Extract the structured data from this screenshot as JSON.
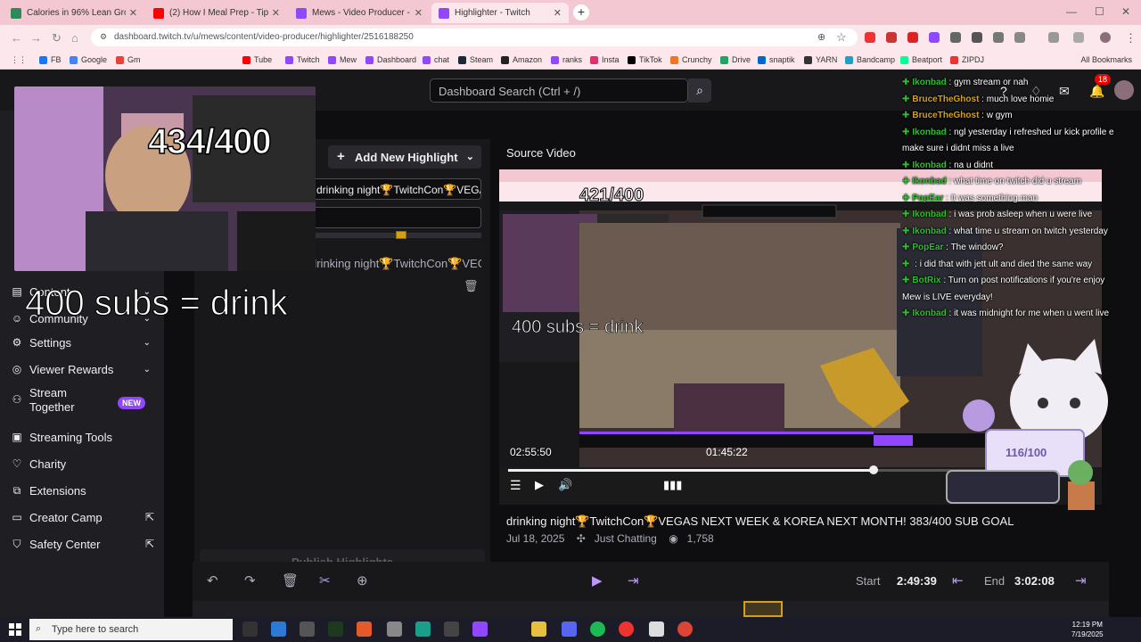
{
  "browser": {
    "tabs": [
      {
        "label": "Calories in 96% Lean Ground B",
        "color": "#2e8b57"
      },
      {
        "label": "(2) How I Meal Prep - Tips & Tr",
        "color": "#ff0000"
      },
      {
        "label": "Mews - Video Producer - Twitc",
        "color": "#9147ff"
      },
      {
        "label": "Highlighter - Twitch",
        "color": "#9147ff"
      }
    ],
    "url": "dashboard.twitch.tv/u/mews/content/video-producer/highlighter/2516188250",
    "bookmarks": [
      "FB",
      "Google",
      "Gm",
      "Tube",
      "Twitch",
      "Mew",
      "Dashboard",
      "chat",
      "Steam",
      "Amazon",
      "ranks",
      "Insta",
      "TikTok",
      "Crunchy",
      "Drive",
      "snaptik",
      "YARN",
      "Bandcamp",
      "Beatport",
      "ZIPDJ"
    ],
    "all_bookmarks": "All Bookmarks"
  },
  "topnav": {
    "search_placeholder": "Dashboard Search (Ctrl + /)",
    "notification_count": "18"
  },
  "sidebar": {
    "items": [
      {
        "label": "Content",
        "icon": "content-icon"
      },
      {
        "label": "Community",
        "icon": "community-icon"
      },
      {
        "label": "Settings",
        "icon": "gear-icon"
      },
      {
        "label": "Viewer Rewards",
        "icon": "rewards-icon"
      },
      {
        "label": "Stream Together",
        "icon": "stream-together-icon",
        "badge": "NEW"
      },
      {
        "label": "Streaming Tools",
        "icon": "camera-icon"
      },
      {
        "label": "Charity",
        "icon": "charity-icon"
      },
      {
        "label": "Extensions",
        "icon": "extensions-icon"
      },
      {
        "label": "Creator Camp",
        "icon": "book-icon"
      },
      {
        "label": "Safety Center",
        "icon": "shield-icon"
      }
    ]
  },
  "highlighter": {
    "add_highlight": "Add New Highlight",
    "title_field": "drinking night🏆TwitchCon🏆VEGAS NEXT W",
    "highlight_title": "drinking night🏆TwitchCon🏆VEGAS ...",
    "publish": "Publish Highlights"
  },
  "source": {
    "label": "Source Video",
    "clip_title": "drinking night🏆TwitchCon🏆VEGAS NEXT WEEK & KOREA NEXT MONTH! 383/400 SUB GOAL",
    "date": "Jul 18, 2025",
    "category": "Just Chatting",
    "views": "1,758",
    "inner_counter": "421/400",
    "inner_overlay": "400 subs = drink",
    "elapsed": "02:55:50",
    "inner_time": "01:45:22",
    "progress": 0.75
  },
  "editor": {
    "start_label": "Start",
    "start_time": "2:49:39",
    "end_label": "End",
    "end_time": "3:02:08"
  },
  "overlay": {
    "sub_counter": "434/400",
    "drink_text": "400 subs = drink",
    "cat_goal": "116/100"
  },
  "chat": [
    {
      "user": "Ikonbad",
      "color": "#2ebf2e",
      "text": "gym stream or nah"
    },
    {
      "user": "BruceTheGhost",
      "color": "#d4a017",
      "text": "much love homie"
    },
    {
      "user": "BruceTheGhost",
      "color": "#d4a017",
      "text": "w gym"
    },
    {
      "user": "Ikonbad",
      "color": "#2ebf2e",
      "text": "ngl yesterday i refreshed ur kick profile e"
    },
    {
      "user": "",
      "color": "#2ebf2e",
      "text": "make sure i didnt miss a live"
    },
    {
      "user": "Ikonbad",
      "color": "#2ebf2e",
      "text": "na u didnt"
    },
    {
      "user": "Ikonbad",
      "color": "#2ebf2e",
      "text": "what time on twitch did u stream"
    },
    {
      "user": "PopEar",
      "color": "#2ebf2e",
      "text": "It was something man"
    },
    {
      "user": "Ikonbad",
      "color": "#2ebf2e",
      "text": "i was prob asleep when u were live"
    },
    {
      "user": "Ikonbad",
      "color": "#2ebf2e",
      "text": "what time u stream on twitch yesterday"
    },
    {
      "user": "PopEar",
      "color": "#2ebf2e",
      "text": "The window?"
    },
    {
      "user": "",
      "color": "#2ebf2e",
      "text": "i did that with jett ult and died the same way"
    },
    {
      "user": "BotRix",
      "color": "#2ebf2e",
      "text": "Turn on post notifications if you're enjoy"
    },
    {
      "user": "",
      "color": "#2ebf2e",
      "text": "Mew is LIVE everyday!"
    },
    {
      "user": "Ikonbad",
      "color": "#2ebf2e",
      "text": "it was midnight for me when u went live"
    }
  ],
  "taskbar": {
    "search": "Type here to search",
    "time": "12:19 PM",
    "date": "7/19/2025"
  }
}
